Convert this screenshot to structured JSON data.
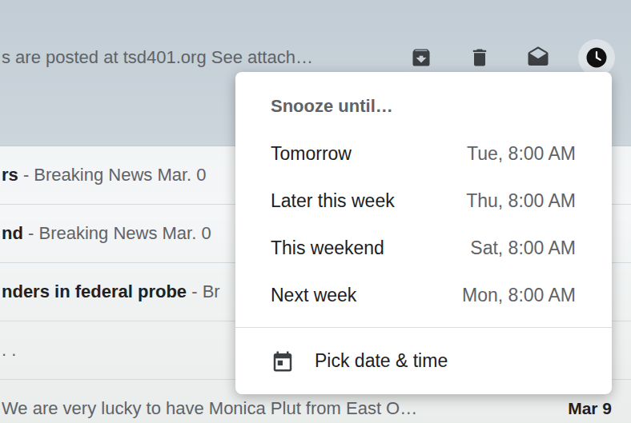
{
  "top_row": {
    "snippet": "s are posted at tsd401.org See attach…",
    "snooze_active": true
  },
  "rows": [
    {
      "sender": "rs",
      "snippet": "- Breaking News Mar. 0",
      "date": "",
      "unread": true
    },
    {
      "sender": "nd",
      "snippet": "- Breaking News Mar. 0",
      "date": "",
      "unread": true
    },
    {
      "sender": "nders in federal probe",
      "snippet": "- Br",
      "date": "",
      "unread": true
    },
    {
      "sender": "",
      "snippet": ". .",
      "date": "",
      "unread": false
    },
    {
      "sender": "",
      "snippet": "We are very lucky to have Monica Plut from East O…",
      "date": "Mar 9",
      "unread": true
    }
  ],
  "menu": {
    "title": "Snooze until…",
    "options": [
      {
        "label": "Tomorrow",
        "time": "Tue, 8:00 AM"
      },
      {
        "label": "Later this week",
        "time": "Thu, 8:00 AM"
      },
      {
        "label": "This weekend",
        "time": "Sat, 8:00 AM"
      },
      {
        "label": "Next week",
        "time": "Mon, 8:00 AM"
      }
    ],
    "custom": {
      "label": "Pick date & time"
    }
  }
}
